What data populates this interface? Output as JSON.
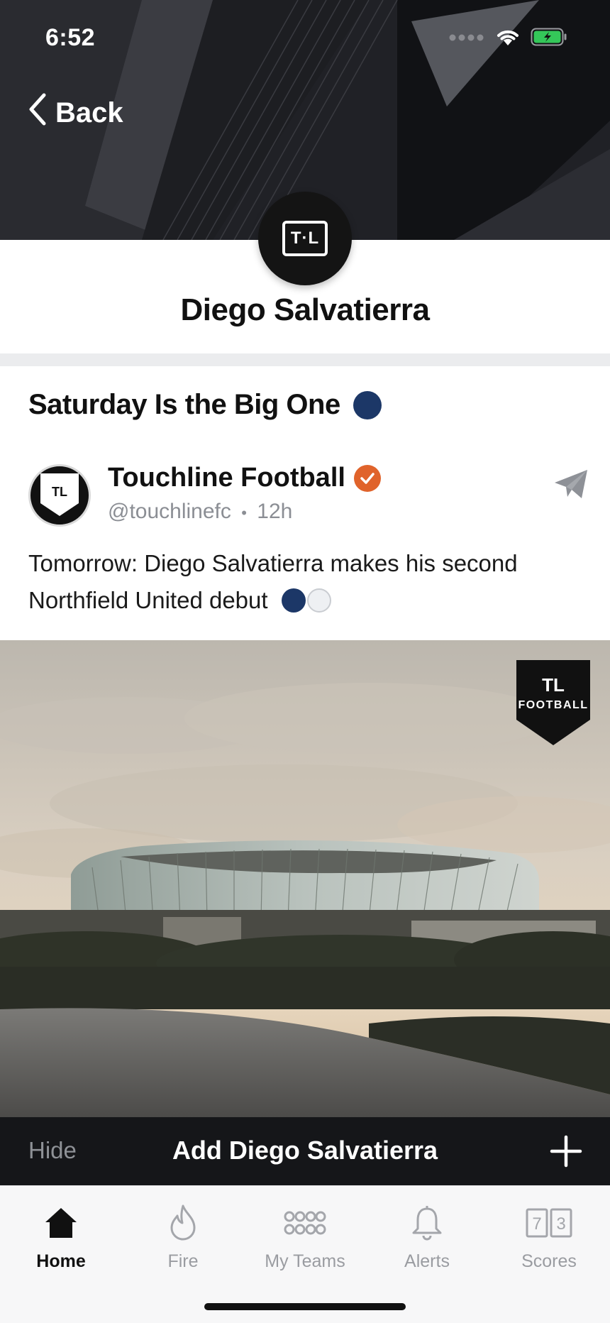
{
  "status_bar": {
    "time": "6:52"
  },
  "header": {
    "back_label": "Back",
    "profile_logo": "T·L",
    "profile_name": "Diego Salvatierra"
  },
  "post": {
    "heading": "Saturday Is the Big One",
    "author_name": "Touchline Football",
    "author_logo": "TL",
    "author_handle": "@touchlinefc",
    "separator": "•",
    "time_ago": "12h",
    "text": "Tomorrow: Diego Salvatierra makes his second Northfield United debut",
    "photo_badge": {
      "line1": "TL",
      "line2": "FOOTBALL"
    }
  },
  "add_bar": {
    "hide_label": "Hide",
    "add_label": "Add Diego Salvatierra"
  },
  "tab_bar": {
    "tabs": [
      {
        "label": "Home",
        "icon": "home-icon",
        "active": true
      },
      {
        "label": "Fire",
        "icon": "fire-icon",
        "active": false
      },
      {
        "label": "My Teams",
        "icon": "teams-grid-icon",
        "active": false
      },
      {
        "label": "Alerts",
        "icon": "bell-icon",
        "active": false
      },
      {
        "label": "Scores",
        "icon": "scores-icon",
        "active": false
      }
    ],
    "scores_icon_digits": [
      "7",
      "3"
    ]
  },
  "colors": {
    "team_navy": "#1c3767",
    "verified_orange": "#e0632b",
    "bar_dark": "#151619"
  }
}
